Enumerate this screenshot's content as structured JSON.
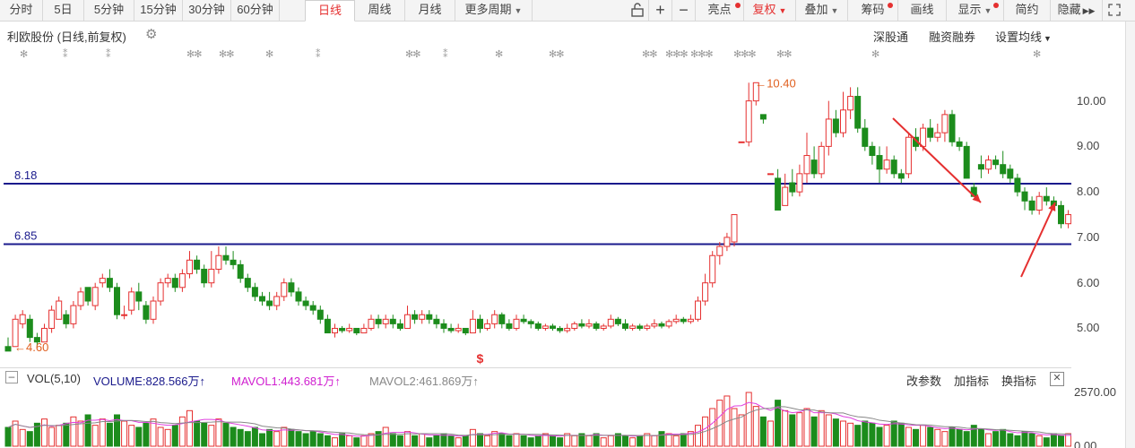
{
  "toolbar": {
    "tabs": [
      {
        "label": "分时"
      },
      {
        "label": "5日"
      },
      {
        "label": "5分钟"
      },
      {
        "label": "15分钟"
      },
      {
        "label": "30分钟"
      },
      {
        "label": "60分钟"
      },
      {
        "label": "日线",
        "active": true
      },
      {
        "label": "周线"
      },
      {
        "label": "月线"
      },
      {
        "label": "更多周期"
      }
    ],
    "right_buttons": [
      {
        "label": "亮点",
        "dot": true
      },
      {
        "label": "复权"
      },
      {
        "label": "叠加"
      },
      {
        "label": "筹码",
        "dot": true
      },
      {
        "label": "画线"
      },
      {
        "label": "显示",
        "dot": true
      },
      {
        "label": "简约"
      },
      {
        "label": "隐藏"
      }
    ],
    "icons": [
      "unlock-icon",
      "plus-icon",
      "minus-icon"
    ]
  },
  "header": {
    "title": "利欧股份 (日线,前复权)",
    "links": [
      "深股通",
      "融资融券",
      "设置均线"
    ]
  },
  "chart_data": {
    "type": "candlestick",
    "y_ticks": [
      "10.00",
      "9.00",
      "8.00",
      "7.00",
      "6.00",
      "5.00"
    ],
    "ylim": [
      4.3,
      10.8
    ],
    "hlines": [
      {
        "label": "8.18",
        "value": 8.18,
        "color": "#1a1a8c"
      },
      {
        "label": "6.85",
        "value": 6.85,
        "color": "#1a1a8c"
      }
    ],
    "annotations": [
      {
        "text": "10.40",
        "value": 10.4,
        "color": "#e06020"
      },
      {
        "text": "4.60",
        "value": 4.6,
        "color": "#e06020"
      }
    ],
    "marker": "$",
    "colors": {
      "up": "#e53030",
      "down": "#1c8c1c",
      "star": "#999999",
      "arrow": "#e53030",
      "ma1": "#e040e0",
      "ma2": "#888888"
    },
    "candles": [
      [
        4.6,
        4.5,
        4.8,
        4.5
      ],
      [
        4.6,
        5.2,
        5.3,
        4.6
      ],
      [
        5.1,
        5.3,
        5.4,
        5.0
      ],
      [
        5.2,
        4.8,
        5.3,
        4.7
      ],
      [
        4.8,
        4.7,
        4.9,
        4.6
      ],
      [
        4.7,
        5.0,
        5.1,
        4.7
      ],
      [
        5.0,
        5.4,
        5.5,
        4.9
      ],
      [
        5.2,
        5.6,
        5.7,
        5.2
      ],
      [
        5.3,
        5.1,
        5.4,
        5.0
      ],
      [
        5.1,
        5.5,
        5.6,
        5.0
      ],
      [
        5.5,
        5.8,
        5.9,
        5.4
      ],
      [
        5.9,
        5.6,
        5.9,
        5.5
      ],
      [
        5.5,
        5.9,
        6.0,
        5.4
      ],
      [
        6.0,
        6.1,
        6.2,
        5.9
      ],
      [
        6.1,
        5.9,
        6.3,
        5.8
      ],
      [
        5.9,
        5.3,
        6.0,
        5.2
      ],
      [
        5.3,
        5.3,
        5.5,
        5.2
      ],
      [
        5.4,
        5.8,
        5.9,
        5.3
      ],
      [
        5.8,
        5.6,
        6.0,
        5.4
      ],
      [
        5.5,
        5.2,
        5.6,
        5.1
      ],
      [
        5.2,
        5.6,
        5.7,
        5.1
      ],
      [
        5.6,
        6.0,
        6.1,
        5.5
      ],
      [
        6.0,
        6.1,
        6.2,
        5.9
      ],
      [
        6.1,
        5.9,
        6.2,
        5.8
      ],
      [
        5.9,
        6.2,
        6.3,
        5.8
      ],
      [
        6.2,
        6.5,
        6.7,
        6.1
      ],
      [
        6.5,
        6.3,
        6.6,
        6.2
      ],
      [
        6.3,
        6.0,
        6.4,
        5.9
      ],
      [
        6.0,
        6.3,
        6.7,
        5.9
      ],
      [
        6.3,
        6.6,
        6.8,
        6.2
      ],
      [
        6.6,
        6.5,
        6.8,
        6.4
      ],
      [
        6.5,
        6.4,
        6.7,
        6.3
      ],
      [
        6.4,
        6.1,
        6.5,
        6.0
      ],
      [
        6.1,
        5.9,
        6.2,
        5.8
      ],
      [
        5.9,
        5.7,
        6.0,
        5.6
      ],
      [
        5.7,
        5.6,
        5.8,
        5.5
      ],
      [
        5.6,
        5.5,
        5.8,
        5.4
      ],
      [
        5.5,
        5.7,
        5.8,
        5.4
      ],
      [
        5.7,
        6.0,
        6.1,
        5.6
      ],
      [
        6.0,
        5.8,
        6.1,
        5.7
      ],
      [
        5.8,
        5.6,
        5.9,
        5.5
      ],
      [
        5.6,
        5.5,
        5.7,
        5.4
      ],
      [
        5.5,
        5.4,
        5.6,
        5.3
      ],
      [
        5.4,
        5.2,
        5.5,
        5.1
      ],
      [
        5.2,
        4.9,
        5.3,
        4.9
      ],
      [
        4.9,
        5.0,
        5.1,
        4.8
      ],
      [
        5.0,
        4.95,
        5.05,
        4.9
      ],
      [
        4.95,
        5.0,
        5.1,
        4.9
      ],
      [
        5.0,
        4.9,
        5.0,
        4.85
      ],
      [
        4.9,
        5.0,
        5.1,
        4.9
      ],
      [
        5.0,
        5.2,
        5.3,
        4.95
      ],
      [
        5.2,
        5.1,
        5.3,
        5.0
      ],
      [
        5.1,
        5.2,
        5.3,
        5.0
      ],
      [
        5.2,
        5.1,
        5.3,
        5.0
      ],
      [
        5.1,
        5.0,
        5.2,
        4.95
      ],
      [
        5.0,
        5.3,
        5.5,
        5.0
      ],
      [
        5.3,
        5.2,
        5.4,
        5.1
      ],
      [
        5.2,
        5.3,
        5.4,
        5.1
      ],
      [
        5.3,
        5.2,
        5.4,
        5.1
      ],
      [
        5.2,
        5.1,
        5.3,
        5.0
      ],
      [
        5.1,
        5.0,
        5.2,
        4.9
      ],
      [
        5.0,
        4.95,
        5.1,
        4.9
      ],
      [
        4.95,
        5.0,
        5.1,
        4.9
      ],
      [
        5.0,
        4.9,
        5.0,
        4.85
      ],
      [
        4.9,
        5.2,
        5.4,
        4.9
      ],
      [
        5.2,
        5.0,
        5.3,
        4.9
      ],
      [
        5.0,
        5.1,
        5.2,
        4.95
      ],
      [
        5.1,
        5.3,
        5.4,
        5.0
      ],
      [
        5.3,
        5.1,
        5.35,
        5.0
      ],
      [
        5.1,
        5.0,
        5.2,
        4.95
      ],
      [
        5.0,
        5.2,
        5.3,
        4.95
      ],
      [
        5.2,
        5.15,
        5.3,
        5.1
      ],
      [
        5.15,
        5.1,
        5.2,
        5.0
      ],
      [
        5.1,
        5.0,
        5.15,
        4.95
      ],
      [
        5.0,
        5.05,
        5.1,
        4.95
      ],
      [
        5.05,
        5.0,
        5.1,
        4.95
      ],
      [
        5.0,
        4.95,
        5.05,
        4.9
      ],
      [
        4.95,
        5.0,
        5.1,
        4.9
      ],
      [
        5.0,
        5.1,
        5.15,
        4.95
      ],
      [
        5.1,
        5.05,
        5.2,
        5.0
      ],
      [
        5.05,
        5.1,
        5.2,
        5.0
      ],
      [
        5.1,
        5.0,
        5.15,
        4.95
      ],
      [
        5.0,
        5.05,
        5.1,
        4.95
      ],
      [
        5.05,
        5.2,
        5.3,
        5.0
      ],
      [
        5.2,
        5.1,
        5.25,
        5.05
      ],
      [
        5.1,
        5.0,
        5.2,
        4.95
      ],
      [
        5.0,
        5.05,
        5.1,
        4.95
      ],
      [
        5.05,
        5.0,
        5.1,
        4.95
      ],
      [
        5.0,
        5.05,
        5.1,
        4.95
      ],
      [
        5.05,
        5.1,
        5.2,
        5.0
      ],
      [
        5.1,
        5.05,
        5.15,
        5.0
      ],
      [
        5.05,
        5.15,
        5.2,
        5.0
      ],
      [
        5.15,
        5.2,
        5.3,
        5.1
      ],
      [
        5.2,
        5.15,
        5.25,
        5.1
      ],
      [
        5.15,
        5.2,
        5.3,
        5.1
      ],
      [
        5.2,
        5.6,
        5.7,
        5.15
      ],
      [
        5.6,
        6.0,
        6.2,
        5.5
      ],
      [
        6.0,
        6.6,
        6.7,
        5.9
      ],
      [
        6.6,
        6.8,
        6.9,
        6.4
      ],
      [
        6.8,
        7.0,
        7.1,
        6.7
      ],
      [
        6.9,
        7.5,
        7.5,
        6.8
      ],
      [
        9.1,
        9.1,
        9.1,
        9.1
      ],
      [
        9.1,
        10.0,
        10.4,
        9.0
      ],
      [
        10.0,
        10.4,
        10.4,
        9.9
      ],
      [
        9.7,
        9.6,
        9.7,
        9.5
      ],
      [
        8.4,
        8.4,
        8.4,
        8.4
      ],
      [
        8.3,
        7.6,
        8.5,
        7.6
      ],
      [
        7.7,
        8.1,
        8.4,
        7.8
      ],
      [
        8.2,
        8.0,
        8.5,
        7.9
      ],
      [
        8.0,
        8.4,
        8.6,
        7.9
      ],
      [
        8.4,
        8.8,
        9.3,
        8.2
      ],
      [
        8.7,
        8.4,
        9.0,
        8.3
      ],
      [
        8.4,
        9.0,
        9.1,
        8.3
      ],
      [
        9.0,
        9.6,
        10.0,
        8.8
      ],
      [
        9.6,
        9.3,
        9.8,
        9.2
      ],
      [
        9.3,
        9.8,
        10.2,
        9.2
      ],
      [
        9.8,
        10.1,
        10.3,
        9.6
      ],
      [
        10.1,
        9.4,
        10.3,
        9.3
      ],
      [
        9.4,
        9.0,
        9.6,
        8.9
      ],
      [
        9.0,
        8.8,
        9.1,
        8.6
      ],
      [
        8.8,
        8.5,
        9.0,
        8.2
      ],
      [
        8.5,
        8.7,
        9.0,
        8.4
      ],
      [
        8.7,
        8.4,
        8.8,
        8.3
      ],
      [
        8.4,
        8.3,
        8.5,
        8.2
      ],
      [
        8.4,
        9.2,
        9.3,
        8.3
      ],
      [
        9.2,
        9.0,
        9.4,
        8.9
      ],
      [
        9.0,
        9.4,
        9.5,
        8.9
      ],
      [
        9.4,
        9.2,
        9.6,
        9.1
      ],
      [
        9.2,
        9.3,
        9.5,
        9.1
      ],
      [
        9.3,
        9.7,
        9.8,
        9.1
      ],
      [
        9.7,
        9.1,
        9.8,
        9.0
      ],
      [
        9.1,
        9.0,
        9.2,
        8.9
      ],
      [
        9.0,
        8.3,
        9.1,
        8.3
      ],
      [
        8.1,
        7.9,
        8.2,
        7.9
      ],
      [
        8.6,
        8.5,
        8.8,
        8.3
      ],
      [
        8.5,
        8.7,
        8.8,
        8.4
      ],
      [
        8.7,
        8.6,
        8.8,
        8.5
      ],
      [
        8.6,
        8.4,
        8.9,
        8.3
      ],
      [
        8.5,
        8.3,
        8.6,
        8.2
      ],
      [
        8.3,
        8.0,
        8.4,
        7.9
      ],
      [
        8.0,
        7.8,
        8.1,
        7.6
      ],
      [
        7.8,
        7.6,
        7.9,
        7.5
      ],
      [
        7.6,
        7.9,
        8.0,
        7.5
      ],
      [
        7.9,
        7.8,
        8.1,
        7.7
      ],
      [
        7.8,
        7.7,
        7.9,
        7.6
      ],
      [
        7.7,
        7.3,
        7.8,
        7.2
      ],
      [
        7.3,
        7.5,
        7.6,
        7.2
      ],
      [
        7.5,
        7.6,
        7.8,
        7.4
      ],
      [
        7.6,
        7.8,
        7.9,
        7.5
      ],
      [
        7.8,
        7.5,
        7.9,
        7.4
      ],
      [
        7.5,
        7.8,
        8.0,
        7.4
      ],
      [
        7.8,
        7.7,
        8.1,
        7.6
      ],
      [
        7.7,
        7.6,
        7.8,
        7.5
      ],
      [
        7.6,
        7.8,
        8.0,
        7.5
      ],
      [
        7.8,
        7.5,
        7.9,
        7.4
      ],
      [
        7.5,
        7.2,
        7.6,
        7.1
      ],
      [
        7.2,
        7.4,
        7.6,
        7.1
      ],
      [
        7.4,
        7.9,
        8.0,
        7.4
      ],
      [
        7.9,
        8.0,
        8.1,
        7.9
      ]
    ],
    "volume": {
      "label": "VOL(5,10)",
      "volume_text": "VOLUME:828.566万",
      "mavol1_text": "MAVOL1:443.681万",
      "mavol2_text": "MAVOL2:461.869万",
      "ylim": [
        0,
        2570
      ],
      "y_ticks": [
        "2570.00",
        "0.00"
      ],
      "values": [
        900,
        1200,
        800,
        700,
        1100,
        1300,
        900,
        1000,
        1100,
        1400,
        1200,
        1500,
        1000,
        1300,
        1100,
        1500,
        1200,
        1000,
        900,
        1100,
        1300,
        900,
        800,
        1000,
        1400,
        1700,
        1200,
        1100,
        1000,
        1300,
        1100,
        900,
        800,
        700,
        900,
        600,
        800,
        700,
        900,
        800,
        700,
        600,
        700,
        600,
        500,
        400,
        600,
        500,
        400,
        500,
        600,
        700,
        900,
        600,
        500,
        700,
        500,
        600,
        400,
        500,
        600,
        500,
        400,
        500,
        800,
        600,
        500,
        700,
        600,
        500,
        600,
        500,
        400,
        500,
        600,
        500,
        400,
        600,
        500,
        600,
        500,
        600,
        400,
        500,
        600,
        500,
        400,
        500,
        600,
        500,
        700,
        600,
        500,
        600,
        700,
        1000,
        1400,
        1800,
        2200,
        2400,
        1800,
        1500,
        2570,
        1900,
        1400,
        1200,
        2200,
        1700,
        1500,
        1600,
        1800,
        1400,
        1700,
        1500,
        1300,
        1200,
        1100,
        1000,
        1200,
        1100,
        900,
        1000,
        1200,
        1100,
        900,
        800,
        1000,
        900,
        800,
        700,
        900,
        800,
        700,
        1000,
        800,
        600,
        700,
        800,
        600,
        500,
        700,
        600,
        500,
        400,
        600,
        500,
        600,
        500,
        700,
        600,
        500,
        400,
        500,
        600,
        500,
        400,
        700,
        800
      ]
    }
  },
  "top_markers": [
    "✻",
    "⁑",
    "⁑",
    "✻✻",
    "✻✻",
    "✻",
    "⁑",
    "✻✻",
    "⁑",
    "✻",
    "✻✻",
    "✻✻",
    "✻✻✻",
    "✻✻✻",
    "✻✻✻",
    "✻✻",
    "✻",
    "✻"
  ],
  "vol_tools": [
    "改参数",
    "加指标",
    "换指标"
  ]
}
